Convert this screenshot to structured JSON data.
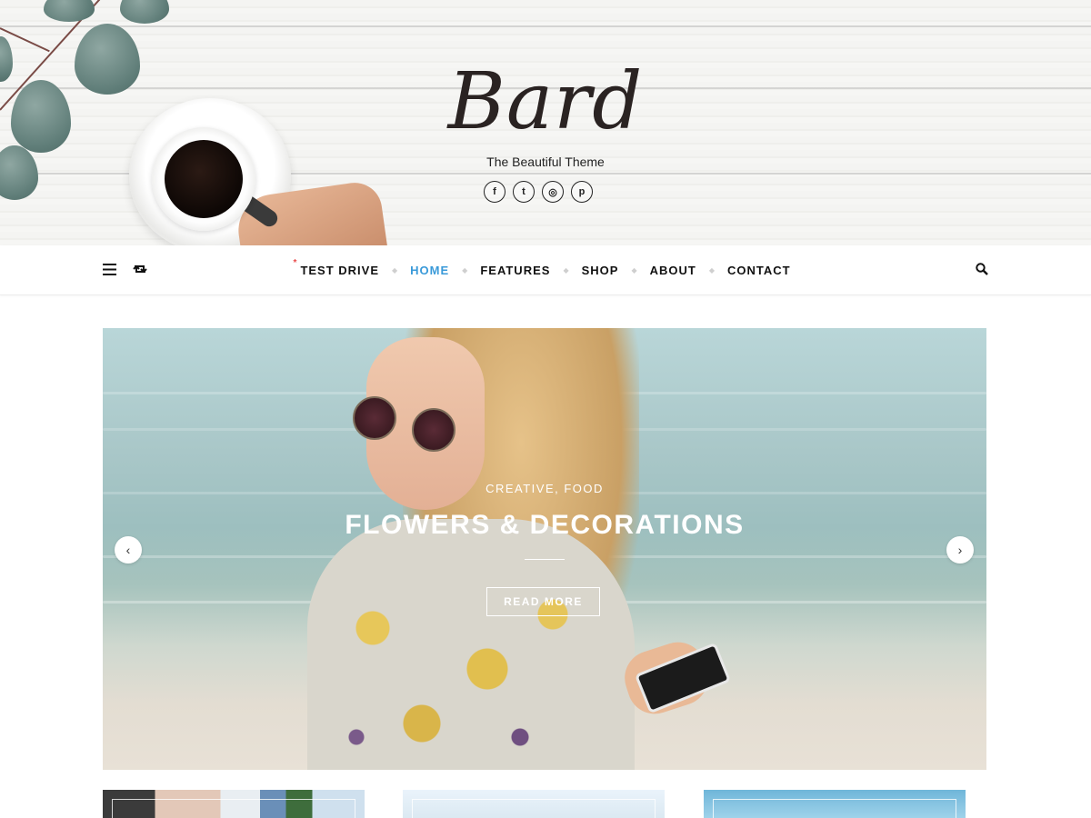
{
  "header": {
    "logo_text": "Bard",
    "tagline": "The Beautiful Theme",
    "socials": [
      {
        "icon": "facebook-icon",
        "glyph": "f"
      },
      {
        "icon": "twitter-icon",
        "glyph": "t"
      },
      {
        "icon": "instagram-icon",
        "glyph": "◎"
      },
      {
        "icon": "pinterest-icon",
        "glyph": "p"
      }
    ]
  },
  "nav": {
    "items": [
      {
        "label": "TEST DRIVE",
        "active": false,
        "starred": true
      },
      {
        "label": "HOME",
        "active": true,
        "starred": false
      },
      {
        "label": "FEATURES",
        "active": false,
        "starred": false
      },
      {
        "label": "SHOP",
        "active": false,
        "starred": false
      },
      {
        "label": "ABOUT",
        "active": false,
        "starred": false
      },
      {
        "label": "CONTACT",
        "active": false,
        "starred": false
      }
    ],
    "star_glyph": "*",
    "separator_glyph": "◆",
    "active_color": "#3a9ad9",
    "icons": {
      "menu": "hamburger-menu-icon",
      "random": "repeat-icon",
      "search": "search-icon"
    }
  },
  "slider": {
    "categories": "CREATIVE, FOOD",
    "title": "FLOWERS & DECORATIONS",
    "button_label": "READ MORE",
    "prev_glyph": "‹",
    "next_glyph": "›"
  }
}
